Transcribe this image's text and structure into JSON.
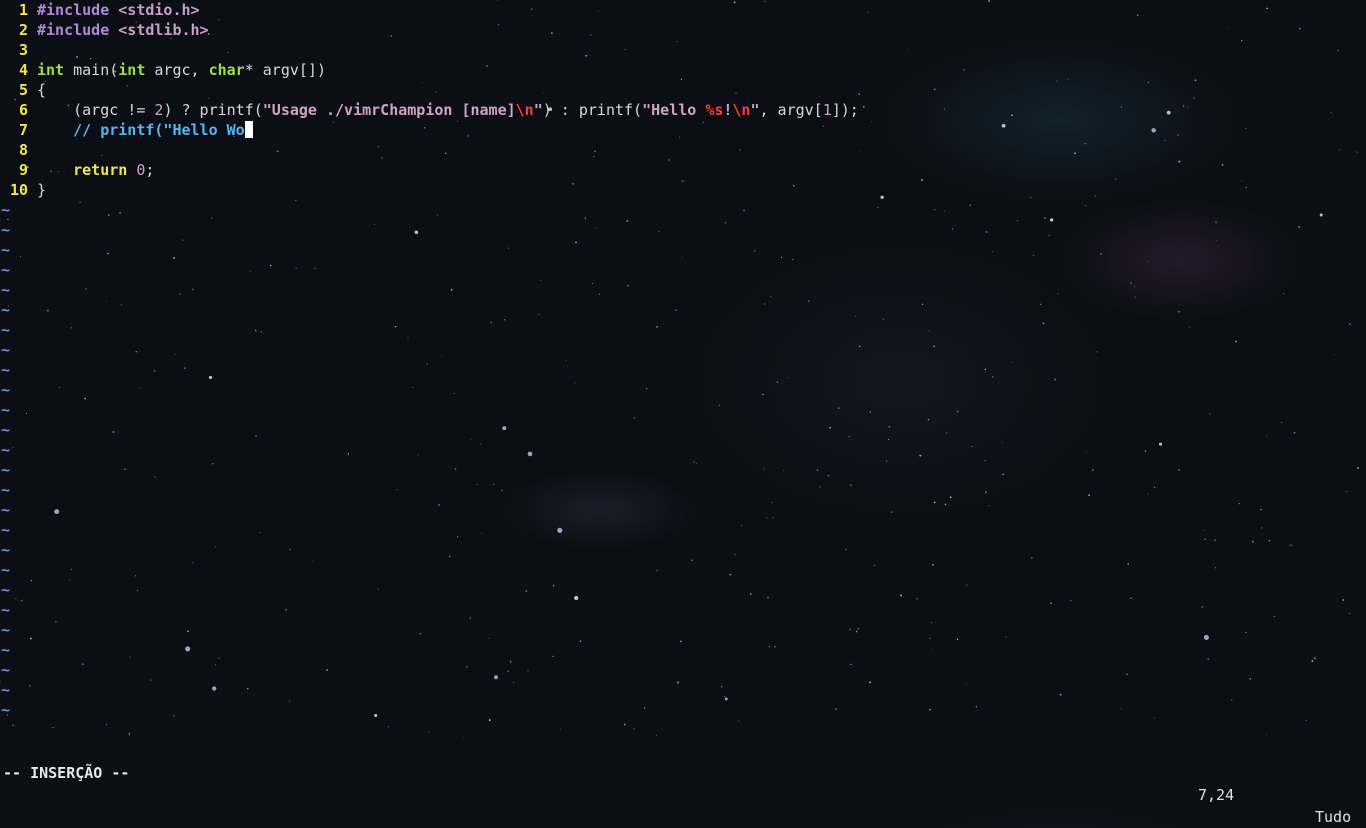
{
  "editor": {
    "lines": [
      {
        "n": "1",
        "tokens": [
          {
            "t": "#include",
            "c": "pre"
          },
          {
            "t": " ",
            "c": "txt"
          },
          {
            "t": "<stdio.h>",
            "c": "inc"
          }
        ]
      },
      {
        "n": "2",
        "tokens": [
          {
            "t": "#include",
            "c": "pre"
          },
          {
            "t": " ",
            "c": "txt"
          },
          {
            "t": "<stdlib.h>",
            "c": "inc"
          }
        ]
      },
      {
        "n": "3",
        "tokens": []
      },
      {
        "n": "4",
        "tokens": [
          {
            "t": "int",
            "c": "type"
          },
          {
            "t": " main(",
            "c": "txt"
          },
          {
            "t": "int",
            "c": "type"
          },
          {
            "t": " argc, ",
            "c": "txt"
          },
          {
            "t": "char",
            "c": "type"
          },
          {
            "t": "* argv[])",
            "c": "txt"
          }
        ]
      },
      {
        "n": "5",
        "tokens": [
          {
            "t": "{",
            "c": "txt"
          }
        ]
      },
      {
        "n": "6",
        "tokens": [
          {
            "t": "    (argc != ",
            "c": "txt"
          },
          {
            "t": "2",
            "c": "num"
          },
          {
            "t": ") ? printf(",
            "c": "txt"
          },
          {
            "t": "\"Usage ./vimrChampion [name]",
            "c": "str"
          },
          {
            "t": "\\n",
            "c": "esc"
          },
          {
            "t": "\"",
            "c": "str"
          },
          {
            "t": ") : printf(",
            "c": "txt"
          },
          {
            "t": "\"Hello ",
            "c": "str"
          },
          {
            "t": "%s",
            "c": "esc"
          },
          {
            "t": "!",
            "c": "str"
          },
          {
            "t": "\\n",
            "c": "esc"
          },
          {
            "t": "\"",
            "c": "str"
          },
          {
            "t": ", argv[",
            "c": "txt"
          },
          {
            "t": "1",
            "c": "num"
          },
          {
            "t": "]);",
            "c": "txt"
          }
        ]
      },
      {
        "n": "7",
        "tokens": [
          {
            "t": "    ",
            "c": "txt"
          },
          {
            "t": "// printf(\"Hello Wo",
            "c": "cmt"
          }
        ],
        "cursor": true
      },
      {
        "n": "8",
        "tokens": []
      },
      {
        "n": "9",
        "tokens": [
          {
            "t": "    ",
            "c": "txt"
          },
          {
            "t": "return",
            "c": "kw"
          },
          {
            "t": " ",
            "c": "txt"
          },
          {
            "t": "0",
            "c": "num"
          },
          {
            "t": ";",
            "c": "txt"
          }
        ]
      },
      {
        "n": "10",
        "tokens": [
          {
            "t": "}",
            "c": "txt"
          }
        ]
      }
    ],
    "empty_marker": "~",
    "empty_line_count": 26
  },
  "statusline": {
    "mode": "-- INSERÇÃO --",
    "position": "7,24",
    "scroll": "Tudo"
  },
  "colors": {
    "line_number": "#f2e64a",
    "preproc": "#b08ad8",
    "type": "#9ee04a",
    "string": "#d0a2c8",
    "escape": "#ff3a3a",
    "keyword": "#f2e64a",
    "comment": "#5ab4f0",
    "tilde": "#6a8fd8",
    "background": "#0b0e14"
  }
}
